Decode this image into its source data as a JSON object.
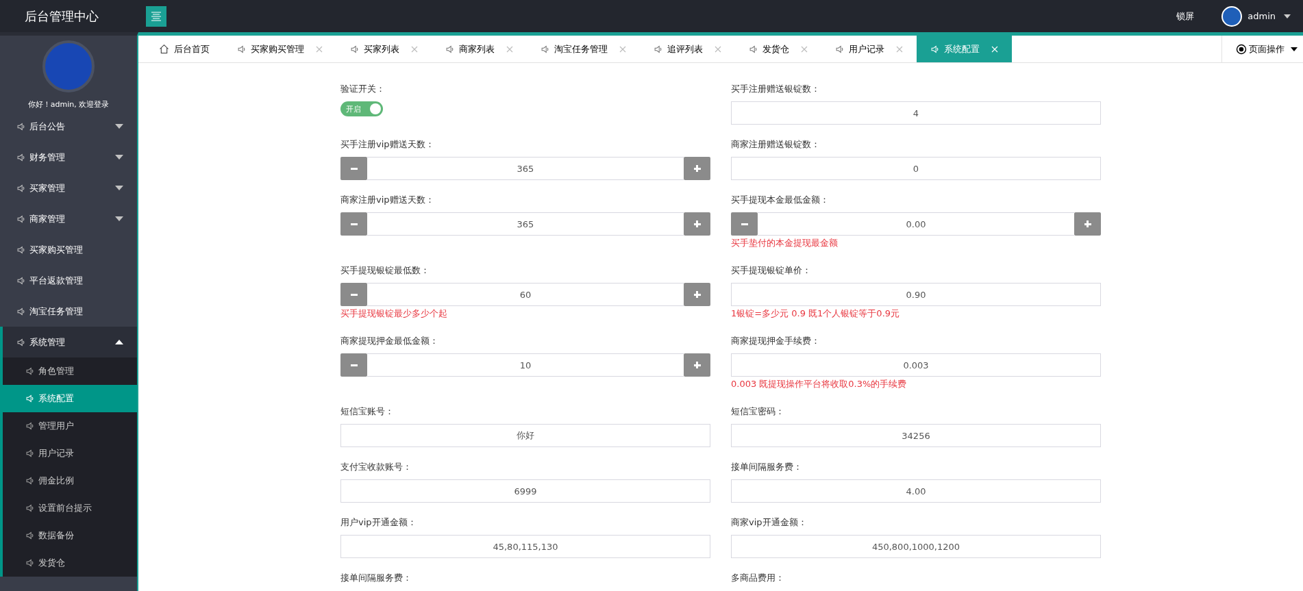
{
  "header": {
    "title": "后台管理中心",
    "lock": "锁屏",
    "user": "admin"
  },
  "sidebar": {
    "greeting": "你好！admin, 欢迎登录",
    "items": [
      {
        "label": "后台公告",
        "expanded": false,
        "selected": false
      },
      {
        "label": "财务管理",
        "expanded": false,
        "selected": false
      },
      {
        "label": "买家管理",
        "expanded": false,
        "selected": false
      },
      {
        "label": "商家管理",
        "expanded": false,
        "selected": false
      },
      {
        "label": "买家购买管理",
        "selected": false
      },
      {
        "label": "平台返款管理",
        "selected": false
      },
      {
        "label": "淘宝任务管理",
        "selected": false
      },
      {
        "label": "系统管理",
        "expanded": true,
        "selected": false,
        "children": [
          {
            "label": "角色管理",
            "selected": false
          },
          {
            "label": "系统配置",
            "selected": true
          },
          {
            "label": "管理用户",
            "selected": false
          },
          {
            "label": "用户记录",
            "selected": false
          },
          {
            "label": "佣金比例",
            "selected": false
          },
          {
            "label": "设置前台提示",
            "selected": false
          },
          {
            "label": "数据备份",
            "selected": false
          },
          {
            "label": "发货仓",
            "selected": false
          }
        ]
      }
    ]
  },
  "tabs": [
    {
      "kind": "home",
      "label": "后台首页",
      "selected": false
    },
    {
      "kind": "page",
      "label": "买家购买管理",
      "selected": false
    },
    {
      "kind": "page",
      "label": "买家列表",
      "selected": false
    },
    {
      "kind": "page",
      "label": "商家列表",
      "selected": false
    },
    {
      "kind": "page",
      "label": "淘宝任务管理",
      "selected": false
    },
    {
      "kind": "page",
      "label": "追评列表",
      "selected": false
    },
    {
      "kind": "page",
      "label": "发货仓",
      "selected": false
    },
    {
      "kind": "page",
      "label": "用户记录",
      "selected": false
    },
    {
      "kind": "page",
      "label": "系统配置",
      "selected": true
    }
  ],
  "page_actions": "页面操作",
  "form": [
    {
      "kind": "switch",
      "label": "验证开关：",
      "on": true,
      "switch_text": "开启"
    },
    {
      "kind": "text",
      "label": "买手注册赠送银锭数：",
      "value": "4"
    },
    {
      "kind": "stepper",
      "label": "买手注册vip赠送天数：",
      "value": "365"
    },
    {
      "kind": "text",
      "label": "商家注册赠送银锭数：",
      "value": "0"
    },
    {
      "kind": "stepper",
      "label": "商家注册vip赠送天数：",
      "value": "365"
    },
    {
      "kind": "stepper",
      "label": "买手提现本金最低金额：",
      "value": "0.00",
      "hint": "买手垫付的本金提现最金额"
    },
    {
      "kind": "stepper",
      "label": "买手提现银锭最低数：",
      "value": "60",
      "hint": "买手提现银锭最少多少个起"
    },
    {
      "kind": "text",
      "label": "买手提现银锭单价：",
      "value": "0.90",
      "hint": "1银锭=多少元 0.9 既1个人银锭等于0.9元"
    },
    {
      "kind": "stepper",
      "label": "商家提现押金最低金额：",
      "value": "10"
    },
    {
      "kind": "text",
      "label": "商家提现押金手续费：",
      "value": "0.003",
      "hint": "0.003 既提现操作平台将收取0.3%的手续费"
    },
    {
      "kind": "text",
      "label": "短信宝账号：",
      "value": "你好"
    },
    {
      "kind": "text",
      "label": "短信宝密码：",
      "value": "34256"
    },
    {
      "kind": "text",
      "label": "支付宝收款账号：",
      "value": "6999"
    },
    {
      "kind": "text",
      "label": "接单间隔服务费：",
      "value": "4.00"
    },
    {
      "kind": "text",
      "label": "用户vip开通金额：",
      "value": "45,80,115,130"
    },
    {
      "kind": "text",
      "label": "商家vip开通金额：",
      "value": "450,800,1000,1200"
    },
    {
      "kind": "label",
      "label": "接单间隔服务费："
    },
    {
      "kind": "label",
      "label": "多商品费用："
    }
  ]
}
